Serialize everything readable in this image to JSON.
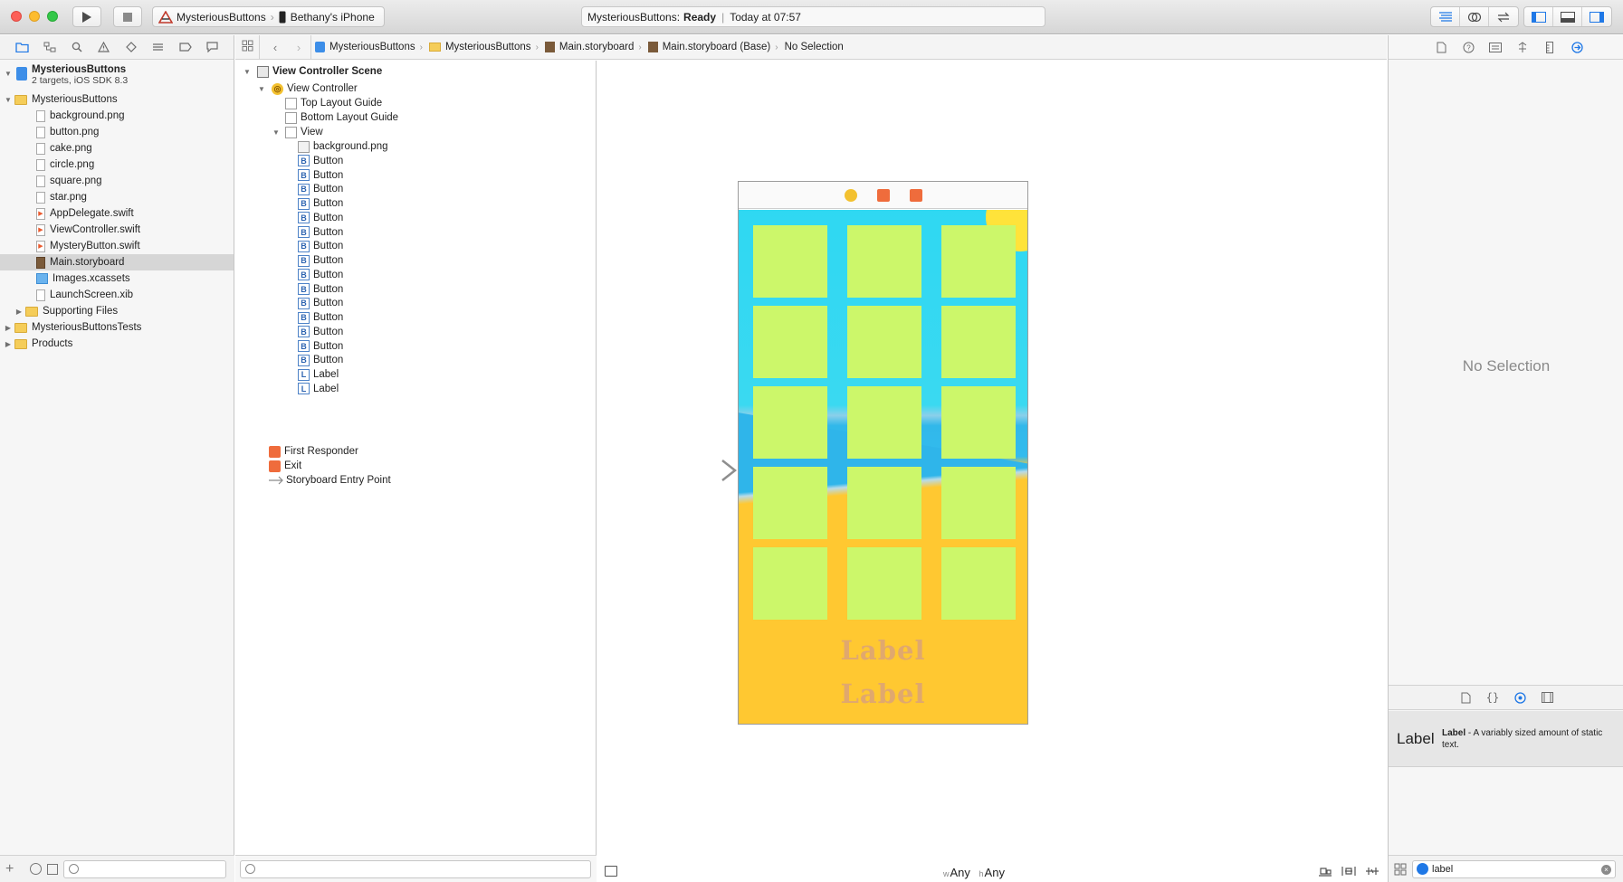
{
  "colors": {
    "accent": "#1f78e6",
    "tile": "#ccf76a",
    "sky": "#2fd8f2",
    "sand": "#ffc831",
    "label_text": "#e0a86e"
  },
  "toolbar": {
    "run_icon": "play-icon",
    "stop_icon": "stop-icon",
    "scheme": "MysteriousButtons",
    "device": "Bethany's iPhone",
    "activity_project": "MysteriousButtons:",
    "activity_status": "Ready",
    "activity_time": "Today at 07:57"
  },
  "navigator": {
    "project": {
      "name": "MysteriousButtons",
      "subtitle": "2 targets, iOS SDK 8.3"
    },
    "items": [
      {
        "label": "MysteriousButtons",
        "kind": "folder",
        "depth": 1,
        "disclosure": "open"
      },
      {
        "label": "background.png",
        "kind": "png",
        "depth": 2
      },
      {
        "label": "button.png",
        "kind": "png",
        "depth": 2
      },
      {
        "label": "cake.png",
        "kind": "png",
        "depth": 2
      },
      {
        "label": "circle.png",
        "kind": "png",
        "depth": 2
      },
      {
        "label": "square.png",
        "kind": "png",
        "depth": 2
      },
      {
        "label": "star.png",
        "kind": "png",
        "depth": 2
      },
      {
        "label": "AppDelegate.swift",
        "kind": "swift",
        "depth": 2
      },
      {
        "label": "ViewController.swift",
        "kind": "swift",
        "depth": 2
      },
      {
        "label": "MysteryButton.swift",
        "kind": "swift",
        "depth": 2
      },
      {
        "label": "Main.storyboard",
        "kind": "storyboard",
        "depth": 2,
        "selected": true
      },
      {
        "label": "Images.xcassets",
        "kind": "xcassets",
        "depth": 2
      },
      {
        "label": "LaunchScreen.xib",
        "kind": "xib",
        "depth": 2
      },
      {
        "label": "Supporting Files",
        "kind": "folder",
        "depth": 2,
        "disclosure": "closed"
      },
      {
        "label": "MysteriousButtonsTests",
        "kind": "folder",
        "depth": 1,
        "disclosure": "closed"
      },
      {
        "label": "Products",
        "kind": "folder",
        "depth": 1,
        "disclosure": "closed"
      }
    ]
  },
  "jumpbar": {
    "crumbs": [
      "MysteriousButtons",
      "MysteriousButtons",
      "Main.storyboard",
      "Main.storyboard (Base)",
      "No Selection"
    ]
  },
  "outline": {
    "scene": "View Controller Scene",
    "view_controller": "View Controller",
    "top_guide": "Top Layout Guide",
    "bottom_guide": "Bottom Layout Guide",
    "view": "View",
    "children": [
      {
        "label": "background.png",
        "kind": "image"
      },
      {
        "label": "Button",
        "kind": "button"
      },
      {
        "label": "Button",
        "kind": "button"
      },
      {
        "label": "Button",
        "kind": "button"
      },
      {
        "label": "Button",
        "kind": "button"
      },
      {
        "label": "Button",
        "kind": "button"
      },
      {
        "label": "Button",
        "kind": "button"
      },
      {
        "label": "Button",
        "kind": "button"
      },
      {
        "label": "Button",
        "kind": "button"
      },
      {
        "label": "Button",
        "kind": "button"
      },
      {
        "label": "Button",
        "kind": "button"
      },
      {
        "label": "Button",
        "kind": "button"
      },
      {
        "label": "Button",
        "kind": "button"
      },
      {
        "label": "Button",
        "kind": "button"
      },
      {
        "label": "Button",
        "kind": "button"
      },
      {
        "label": "Button",
        "kind": "button"
      },
      {
        "label": "Label",
        "kind": "label"
      },
      {
        "label": "Label",
        "kind": "label"
      }
    ],
    "first_responder": "First Responder",
    "exit": "Exit",
    "entry_point": "Storyboard Entry Point"
  },
  "canvas": {
    "labels": [
      "Label",
      "Label"
    ],
    "grid": {
      "rows": 5,
      "cols": 3
    },
    "size_class": {
      "w_prefix": "w",
      "w": "Any",
      "h_prefix": "h",
      "h": "Any"
    }
  },
  "utilities": {
    "no_selection": "No Selection",
    "library_item": {
      "title": "Label",
      "desc_title": "Label",
      "desc": " - A variably sized amount of static text."
    },
    "search_value": "label"
  }
}
